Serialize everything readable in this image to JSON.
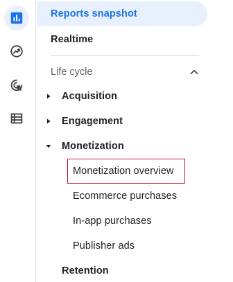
{
  "rail": {
    "icons": [
      {
        "name": "reports-icon",
        "active": true
      },
      {
        "name": "explore-icon",
        "active": false
      },
      {
        "name": "advertising-icon",
        "active": false
      },
      {
        "name": "configure-icon",
        "active": false
      }
    ]
  },
  "nav": {
    "reports_snapshot": "Reports snapshot",
    "realtime": "Realtime",
    "section_label": "Life cycle",
    "acquisition": "Acquisition",
    "engagement": "Engagement",
    "monetization": "Monetization",
    "monetization_children": [
      "Monetization overview",
      "Ecommerce purchases",
      "In-app purchases",
      "Publisher ads"
    ],
    "retention": "Retention"
  },
  "colors": {
    "accent": "#1a73e8",
    "selected_bg": "#e8f0fe",
    "highlight": "#c8102e"
  }
}
